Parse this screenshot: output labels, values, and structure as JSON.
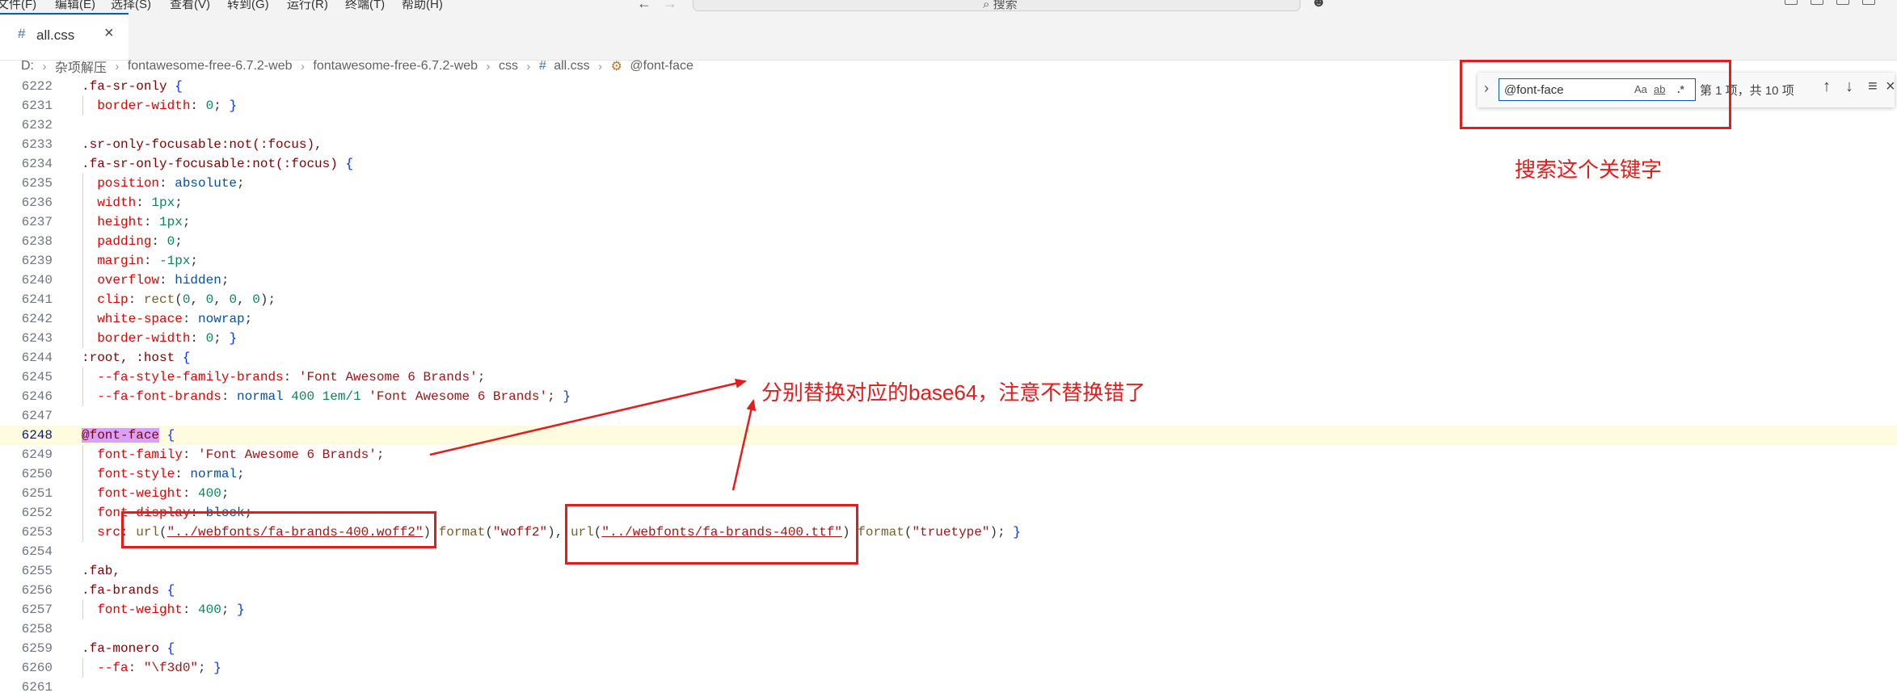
{
  "menubar": {
    "items": [
      "文件(F)",
      "编辑(E)",
      "选择(S)",
      "查看(V)",
      "转到(G)",
      "运行(R)",
      "终端(T)",
      "帮助(H)"
    ],
    "search_label": "搜索"
  },
  "tab": {
    "icon": "#",
    "label": "all.css"
  },
  "breadcrumb": [
    "D:",
    "杂项解压",
    "fontawesome-free-6.7.2-web",
    "fontawesome-free-6.7.2-web",
    "css",
    "all.css",
    "@font-face"
  ],
  "find": {
    "value": "@font-face",
    "match_case": "Aa",
    "whole_word": "ab",
    "regex": ".*",
    "result": "第 1 项，共 10 项"
  },
  "editor": {
    "current_line": 6248,
    "lines": [
      {
        "n": 6222,
        "t": [
          [
            ".fa-sr-only",
            "s"
          ],
          [
            " ",
            "p"
          ],
          [
            "{",
            "b"
          ]
        ]
      },
      {
        "n": 6231,
        "t": [
          [
            "  ",
            "p"
          ],
          [
            "border-width",
            "k"
          ],
          [
            ": ",
            "p"
          ],
          [
            "0",
            "n"
          ],
          [
            "; ",
            "p"
          ],
          [
            "}",
            "b"
          ]
        ]
      },
      {
        "n": 6232,
        "t": []
      },
      {
        "n": 6233,
        "t": [
          [
            ".sr-only-focusable:not(:focus)",
            "s"
          ],
          [
            ",",
            "p"
          ]
        ]
      },
      {
        "n": 6234,
        "t": [
          [
            ".fa-sr-only-focusable:not(:focus)",
            "s"
          ],
          [
            " ",
            "p"
          ],
          [
            "{",
            "b"
          ]
        ]
      },
      {
        "n": 6235,
        "t": [
          [
            "  ",
            "p"
          ],
          [
            "position",
            "k"
          ],
          [
            ": ",
            "p"
          ],
          [
            "absolute",
            "v"
          ],
          [
            ";",
            "p"
          ]
        ]
      },
      {
        "n": 6236,
        "t": [
          [
            "  ",
            "p"
          ],
          [
            "width",
            "k"
          ],
          [
            ": ",
            "p"
          ],
          [
            "1px",
            "n"
          ],
          [
            ";",
            "p"
          ]
        ]
      },
      {
        "n": 6237,
        "t": [
          [
            "  ",
            "p"
          ],
          [
            "height",
            "k"
          ],
          [
            ": ",
            "p"
          ],
          [
            "1px",
            "n"
          ],
          [
            ";",
            "p"
          ]
        ]
      },
      {
        "n": 6238,
        "t": [
          [
            "  ",
            "p"
          ],
          [
            "padding",
            "k"
          ],
          [
            ": ",
            "p"
          ],
          [
            "0",
            "n"
          ],
          [
            ";",
            "p"
          ]
        ]
      },
      {
        "n": 6239,
        "t": [
          [
            "  ",
            "p"
          ],
          [
            "margin",
            "k"
          ],
          [
            ": ",
            "p"
          ],
          [
            "-1px",
            "n"
          ],
          [
            ";",
            "p"
          ]
        ]
      },
      {
        "n": 6240,
        "t": [
          [
            "  ",
            "p"
          ],
          [
            "overflow",
            "k"
          ],
          [
            ": ",
            "p"
          ],
          [
            "hidden",
            "v"
          ],
          [
            ";",
            "p"
          ]
        ]
      },
      {
        "n": 6241,
        "t": [
          [
            "  ",
            "p"
          ],
          [
            "clip",
            "k"
          ],
          [
            ": ",
            "p"
          ],
          [
            "rect",
            "f"
          ],
          [
            "(",
            "p"
          ],
          [
            "0",
            "n"
          ],
          [
            ", ",
            "p"
          ],
          [
            "0",
            "n"
          ],
          [
            ", ",
            "p"
          ],
          [
            "0",
            "n"
          ],
          [
            ", ",
            "p"
          ],
          [
            "0",
            "n"
          ],
          [
            ");",
            "p"
          ]
        ]
      },
      {
        "n": 6242,
        "t": [
          [
            "  ",
            "p"
          ],
          [
            "white-space",
            "k"
          ],
          [
            ": ",
            "p"
          ],
          [
            "nowrap",
            "v"
          ],
          [
            ";",
            "p"
          ]
        ]
      },
      {
        "n": 6243,
        "t": [
          [
            "  ",
            "p"
          ],
          [
            "border-width",
            "k"
          ],
          [
            ": ",
            "p"
          ],
          [
            "0",
            "n"
          ],
          [
            "; ",
            "p"
          ],
          [
            "}",
            "b"
          ]
        ]
      },
      {
        "n": 6244,
        "t": [
          [
            ":root, :host",
            "s"
          ],
          [
            " ",
            "p"
          ],
          [
            "{",
            "b"
          ]
        ]
      },
      {
        "n": 6245,
        "t": [
          [
            "  ",
            "p"
          ],
          [
            "--fa-style-family-brands",
            "k"
          ],
          [
            ": ",
            "p"
          ],
          [
            "'Font Awesome 6 Brands'",
            "q"
          ],
          [
            ";",
            "p"
          ]
        ]
      },
      {
        "n": 6246,
        "t": [
          [
            "  ",
            "p"
          ],
          [
            "--fa-font-brands",
            "k"
          ],
          [
            ": ",
            "p"
          ],
          [
            "normal ",
            "v"
          ],
          [
            "400 1em/1 ",
            "n"
          ],
          [
            "'Font Awesome 6 Brands'",
            "q"
          ],
          [
            "; ",
            "p"
          ],
          [
            "}",
            "b"
          ]
        ]
      },
      {
        "n": 6247,
        "t": []
      },
      {
        "n": 6248,
        "t": [
          [
            "@font-face",
            "m"
          ],
          [
            " ",
            "p"
          ],
          [
            "{",
            "b"
          ]
        ]
      },
      {
        "n": 6249,
        "t": [
          [
            "  ",
            "p"
          ],
          [
            "font-family",
            "k"
          ],
          [
            ": ",
            "p"
          ],
          [
            "'Font Awesome 6 Brands'",
            "q"
          ],
          [
            ";",
            "p"
          ]
        ]
      },
      {
        "n": 6250,
        "t": [
          [
            "  ",
            "p"
          ],
          [
            "font-style",
            "k"
          ],
          [
            ": ",
            "p"
          ],
          [
            "normal",
            "v"
          ],
          [
            ";",
            "p"
          ]
        ]
      },
      {
        "n": 6251,
        "t": [
          [
            "  ",
            "p"
          ],
          [
            "font-weight",
            "k"
          ],
          [
            ": ",
            "p"
          ],
          [
            "400",
            "n"
          ],
          [
            ";",
            "p"
          ]
        ]
      },
      {
        "n": 6252,
        "t": [
          [
            "  ",
            "p"
          ],
          [
            "font-display",
            "k"
          ],
          [
            ": ",
            "p"
          ],
          [
            "block",
            "v"
          ],
          [
            ";",
            "p"
          ]
        ]
      },
      {
        "n": 6253,
        "t": [
          [
            "  ",
            "p"
          ],
          [
            "src",
            "k"
          ],
          [
            ": ",
            "p"
          ],
          [
            "url",
            "f"
          ],
          [
            "(",
            "p"
          ],
          [
            "\"../webfonts/fa-brands-400.woff2\"",
            "u"
          ],
          [
            ") ",
            "p"
          ],
          [
            "format",
            "f"
          ],
          [
            "(",
            "p"
          ],
          [
            "\"woff2\"",
            "q"
          ],
          [
            "), ",
            "p"
          ],
          [
            "url",
            "f"
          ],
          [
            "(",
            "p"
          ],
          [
            "\"../webfonts/fa-brands-400.ttf\"",
            "u"
          ],
          [
            ") ",
            "p"
          ],
          [
            "format",
            "f"
          ],
          [
            "(",
            "p"
          ],
          [
            "\"truetype\"",
            "q"
          ],
          [
            "); ",
            "p"
          ],
          [
            "}",
            "b"
          ]
        ]
      },
      {
        "n": 6254,
        "t": []
      },
      {
        "n": 6255,
        "t": [
          [
            ".fab",
            "s"
          ],
          [
            ",",
            "p"
          ]
        ]
      },
      {
        "n": 6256,
        "t": [
          [
            ".fa-brands",
            "s"
          ],
          [
            " ",
            "p"
          ],
          [
            "{",
            "b"
          ]
        ]
      },
      {
        "n": 6257,
        "t": [
          [
            "  ",
            "p"
          ],
          [
            "font-weight",
            "k"
          ],
          [
            ": ",
            "p"
          ],
          [
            "400",
            "n"
          ],
          [
            "; ",
            "p"
          ],
          [
            "}",
            "b"
          ]
        ]
      },
      {
        "n": 6258,
        "t": []
      },
      {
        "n": 6259,
        "t": [
          [
            ".fa-monero",
            "s"
          ],
          [
            " ",
            "p"
          ],
          [
            "{",
            "b"
          ]
        ]
      },
      {
        "n": 6260,
        "t": [
          [
            "  ",
            "p"
          ],
          [
            "--fa",
            "k"
          ],
          [
            ": ",
            "p"
          ],
          [
            "\"\\f3d0\"",
            "q"
          ],
          [
            "; ",
            "p"
          ],
          [
            "}",
            "b"
          ]
        ]
      },
      {
        "n": 6261,
        "t": []
      }
    ]
  },
  "annotations": {
    "search_note": "搜索这个关键字",
    "replace_note": "分别替换对应的base64，注意不替换错了",
    "color": "#e61c1c"
  }
}
